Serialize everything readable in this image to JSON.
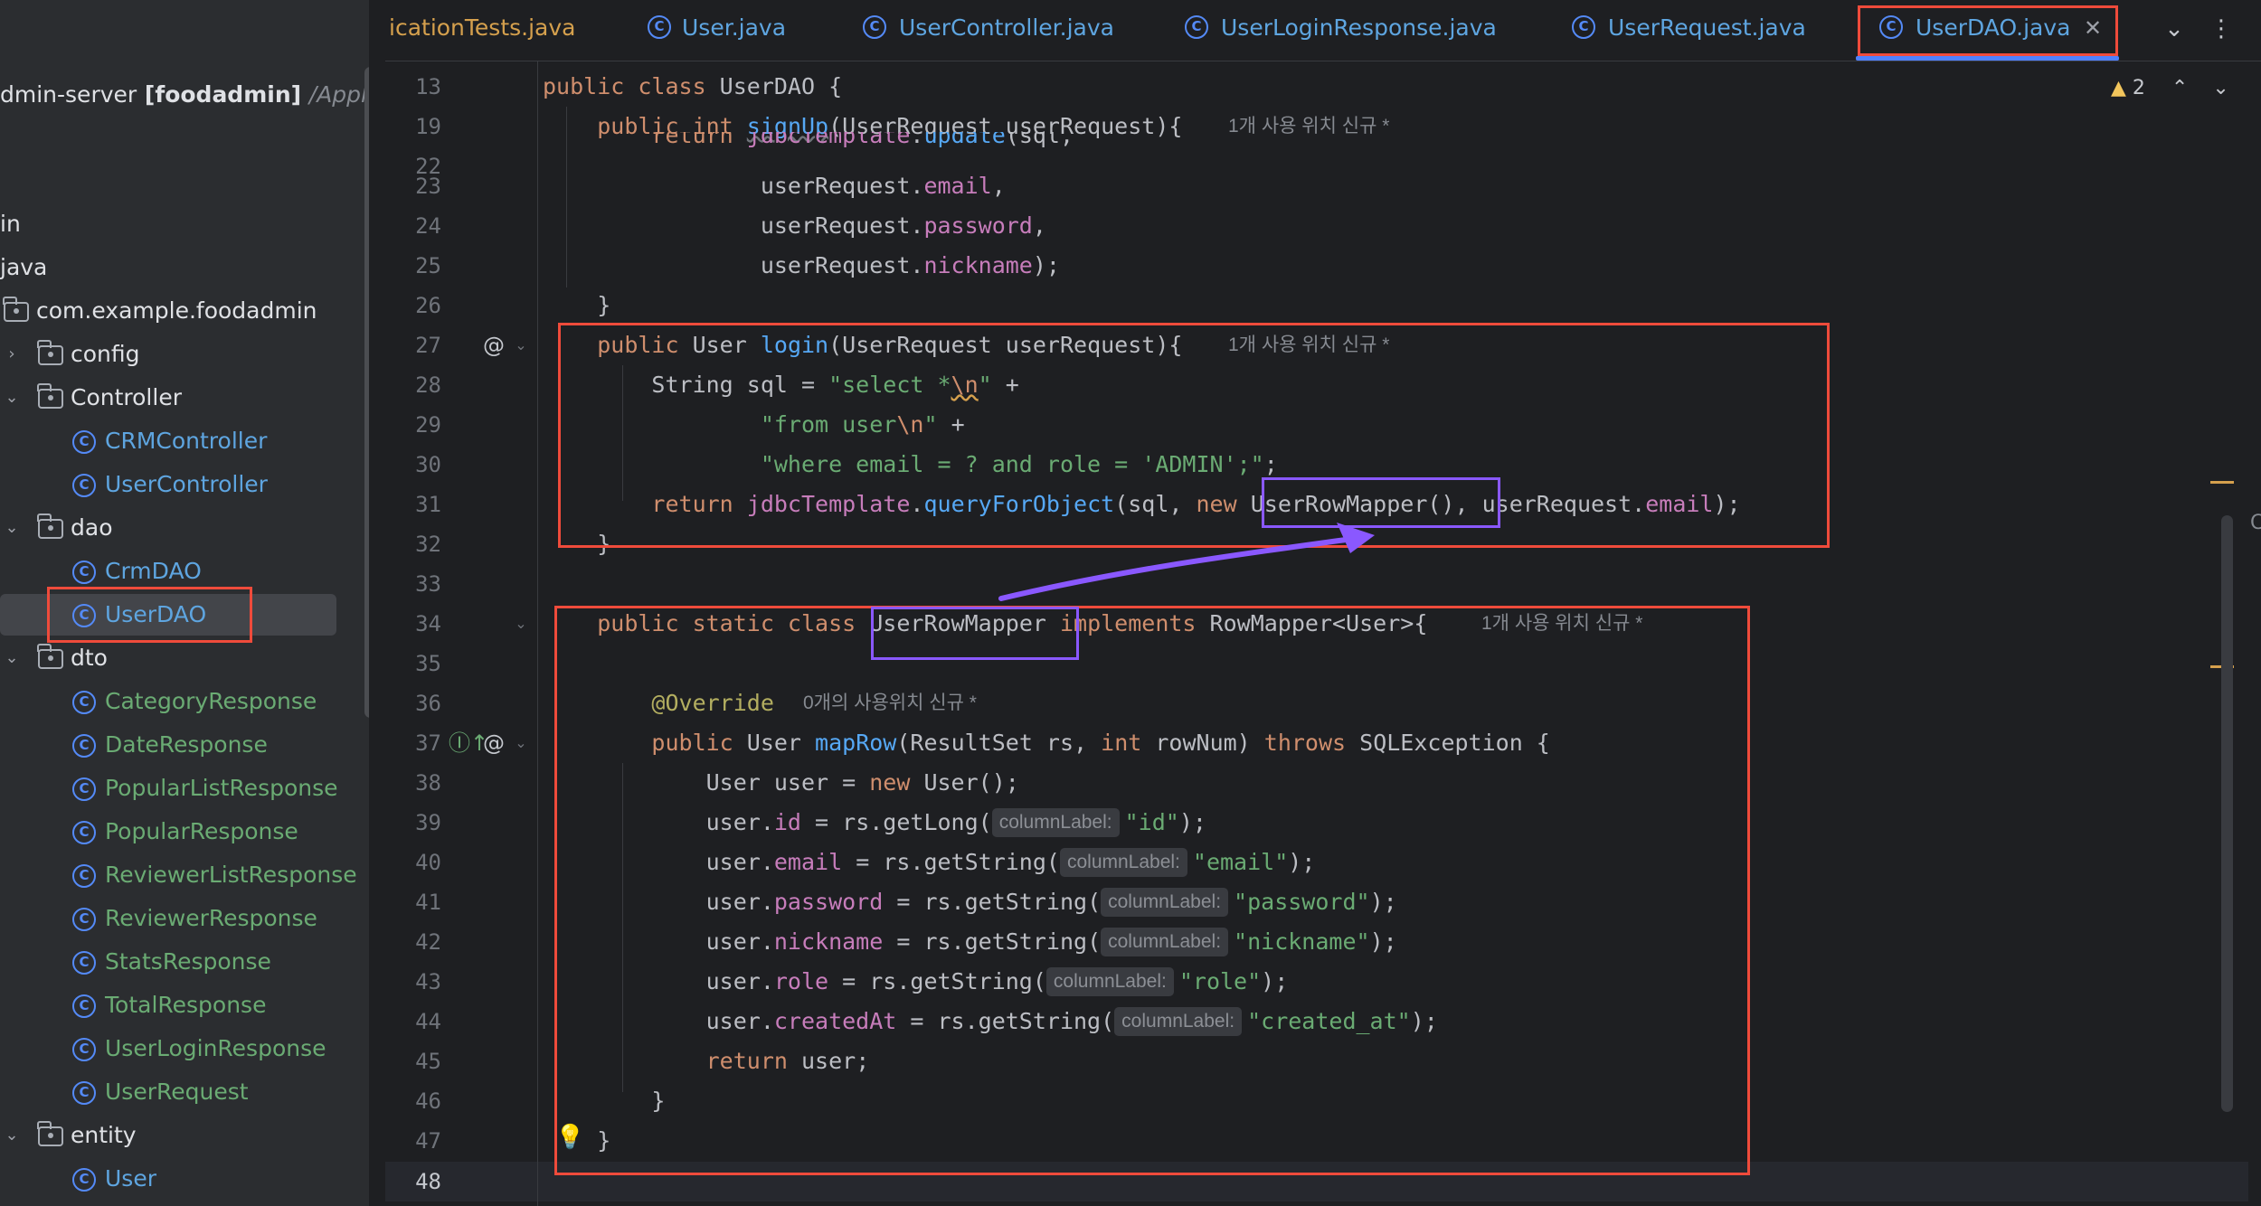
{
  "colors": {
    "sidebar_bg": "#2b2d30",
    "editor_bg": "#1e1f22",
    "keyword": "#cf8e6d",
    "method": "#56a8f5",
    "field": "#c77dbb",
    "string": "#6aab73",
    "annotation": "#b3ae60",
    "highlight_red": "#ef4b3b",
    "highlight_purple": "#8a58ff",
    "active_tab_underline": "#4f80ff"
  },
  "sidebar": {
    "project_name": "dmin-server",
    "project_module": "[foodadmin]",
    "project_path": "/Applic",
    "items": [
      {
        "label": "in",
        "icon": "none"
      },
      {
        "label": "java",
        "icon": "none"
      },
      {
        "label": "com.example.foodadmin",
        "icon": "package-folder-icon"
      },
      {
        "label": "config",
        "icon": "package-folder-icon",
        "expander": "›"
      },
      {
        "label": "Controller",
        "icon": "package-folder-icon",
        "expander": "⌄"
      },
      {
        "label": "CRMController",
        "icon": "class-icon"
      },
      {
        "label": "UserController",
        "icon": "class-icon"
      },
      {
        "label": "dao",
        "icon": "package-folder-icon",
        "expander": "⌄"
      },
      {
        "label": "CrmDAO",
        "icon": "class-icon"
      },
      {
        "label": "UserDAO",
        "icon": "class-icon",
        "selected": true
      },
      {
        "label": "dto",
        "icon": "package-folder-icon",
        "expander": "⌄"
      },
      {
        "label": "CategoryResponse",
        "icon": "class-icon"
      },
      {
        "label": "DateResponse",
        "icon": "class-icon"
      },
      {
        "label": "PopularListResponse",
        "icon": "class-icon"
      },
      {
        "label": "PopularResponse",
        "icon": "class-icon"
      },
      {
        "label": "ReviewerListResponse",
        "icon": "class-icon"
      },
      {
        "label": "ReviewerResponse",
        "icon": "class-icon"
      },
      {
        "label": "StatsResponse",
        "icon": "class-icon"
      },
      {
        "label": "TotalResponse",
        "icon": "class-icon"
      },
      {
        "label": "UserLoginResponse",
        "icon": "class-icon"
      },
      {
        "label": "UserRequest",
        "icon": "class-icon"
      },
      {
        "label": "entity",
        "icon": "package-folder-icon",
        "expander": "⌄"
      },
      {
        "label": "User",
        "icon": "class-icon"
      }
    ]
  },
  "tabs": [
    {
      "label": "icationTests.java",
      "active": false
    },
    {
      "label": "User.java",
      "active": false
    },
    {
      "label": "UserController.java",
      "active": false
    },
    {
      "label": "UserLoginResponse.java",
      "active": false
    },
    {
      "label": "UserRequest.java",
      "active": false
    },
    {
      "label": "UserDAO.java",
      "active": true
    }
  ],
  "tab_icon_glyph": "C",
  "tab_close_glyph": "✕",
  "tabbar_actions": {
    "more_tabs_glyph": "⌄",
    "options_glyph": "⋮"
  },
  "inspection": {
    "warning_glyph": "▲",
    "warning_count": "2",
    "up_glyph": "⌃",
    "down_glyph": "⌄"
  },
  "editor": {
    "line_numbers": [
      "13",
      "19",
      "22",
      "23",
      "24",
      "25",
      "26",
      "27",
      "28",
      "29",
      "30",
      "31",
      "32",
      "33",
      "34",
      "35",
      "36",
      "37",
      "38",
      "39",
      "40",
      "41",
      "42",
      "43",
      "44",
      "45",
      "46",
      "47",
      "48"
    ],
    "usage_hints": {
      "signUp": "1개 사용 위치   신규 *",
      "login": "1개 사용 위치   신규 *",
      "userRowMapper": "1개 사용 위치   신규 *",
      "override": "0개의 사용위치   신규 *"
    },
    "param_hint": "columnLabel:",
    "gutter_icons": {
      "at_glyph": "@",
      "impl_glyph": "Ⓘ↑",
      "bulb_glyph": "💡"
    },
    "fold_glyph": "⌄",
    "edge_letter": "C"
  }
}
